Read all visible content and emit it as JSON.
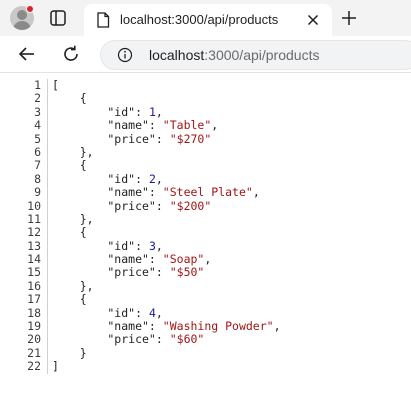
{
  "tab": {
    "title": "localhost:3000/api/products"
  },
  "address": {
    "host": "localhost",
    "path": ":3000/api/products"
  },
  "icons": {
    "profile": "profile-avatar-icon",
    "tab_actions": "tab-actions-icon",
    "favicon": "page-icon",
    "close": "close-icon",
    "new_tab": "plus-icon",
    "back": "back-arrow-icon",
    "reload": "reload-icon",
    "info": "info-icon"
  },
  "colors": {
    "string": "#a31515",
    "number": "#1a1aa6",
    "notification_dot": "#d9262c"
  },
  "json_products": [
    {
      "id": 1,
      "name": "Table",
      "price": "$270"
    },
    {
      "id": 2,
      "name": "Steel Plate",
      "price": "$200"
    },
    {
      "id": 3,
      "name": "Soap",
      "price": "$50"
    },
    {
      "id": 4,
      "name": "Washing Powder",
      "price": "$60"
    }
  ],
  "line_numbers": [
    "1",
    "2",
    "3",
    "4",
    "5",
    "6",
    "7",
    "8",
    "9",
    "10",
    "11",
    "12",
    "13",
    "14",
    "15",
    "16",
    "17",
    "18",
    "19",
    "20",
    "21",
    "22"
  ]
}
